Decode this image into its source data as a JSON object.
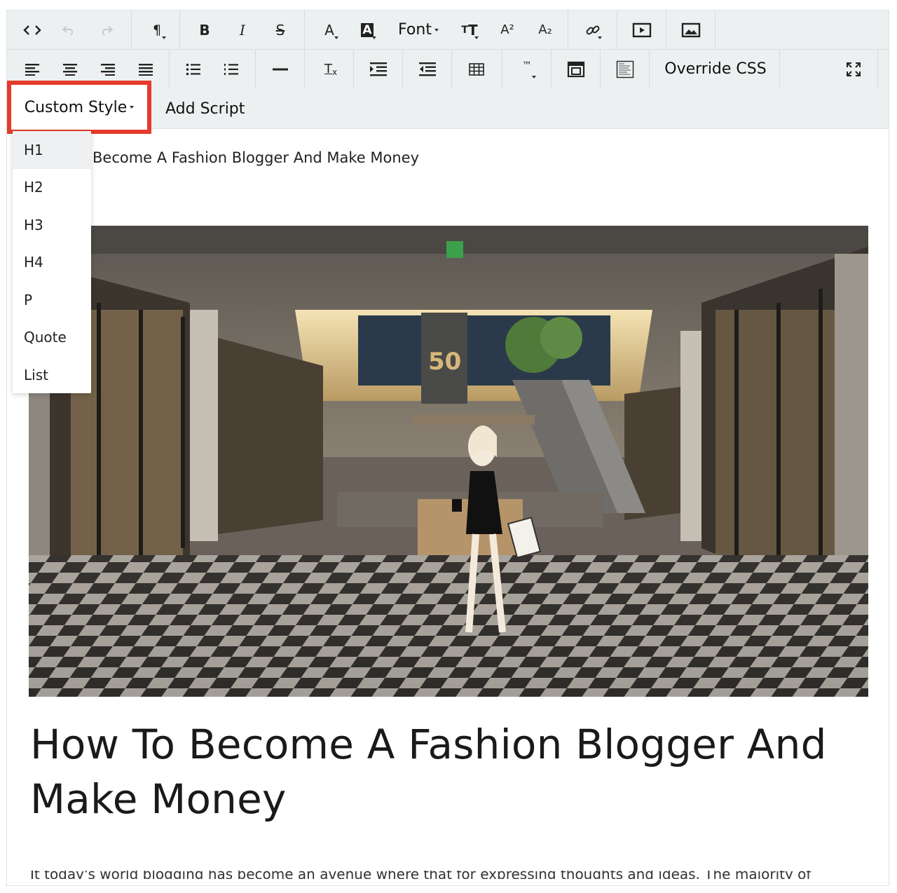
{
  "toolbar": {
    "font_label": "Font",
    "override_css_label": "Override CSS",
    "custom_style_label": "Custom Style",
    "add_script_label": "Add Script",
    "bold_label": "B",
    "italic_label": "I",
    "strike_label": "S",
    "text_color_label": "A",
    "bg_color_label": "A",
    "superscript_label": "A²",
    "subscript_label": "A₂",
    "trademark_label": "™",
    "clear_format_label": "Tx",
    "paragraph_label": "¶"
  },
  "dropdown": {
    "items": [
      {
        "label": "H1"
      },
      {
        "label": "H2"
      },
      {
        "label": "H3"
      },
      {
        "label": "H4"
      },
      {
        "label": "P"
      },
      {
        "label": "Quote"
      },
      {
        "label": "List"
      }
    ]
  },
  "document": {
    "title": "Become A Fashion Blogger And Make Money",
    "headline": "How To Become A Fashion Blogger And Make Money",
    "cutoff_text": "It today's world blogging has become an avenue where that for expressing thoughts and ideas. The majority of"
  },
  "colors": {
    "toolbar_bg": "#edf0f1",
    "highlight": "#e53b2a"
  }
}
